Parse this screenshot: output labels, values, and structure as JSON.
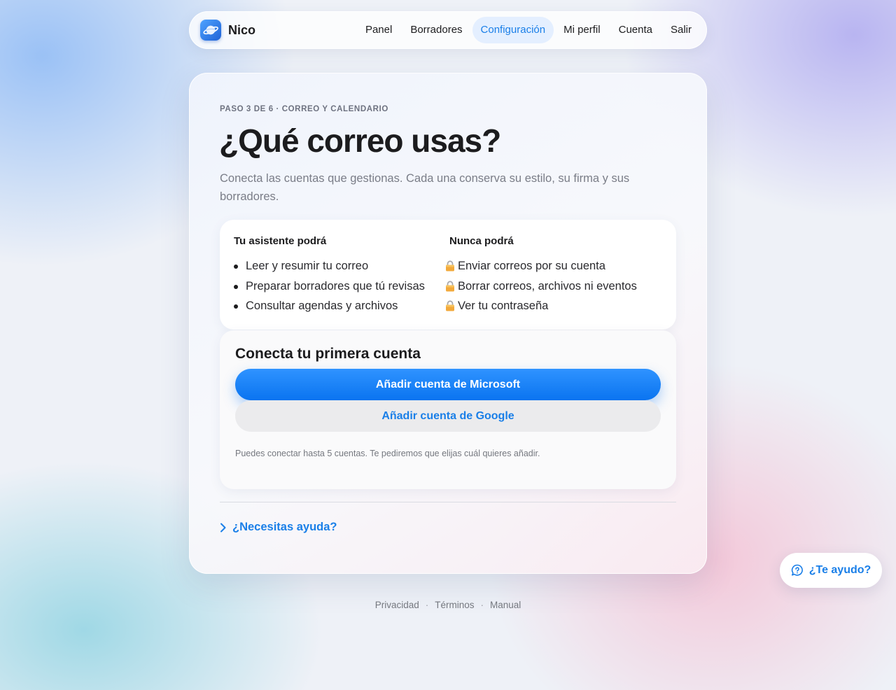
{
  "app": {
    "name": "Nico",
    "logo_icon": "planet-icon",
    "accent_color": "#1a7fe8"
  },
  "nav": {
    "items": [
      {
        "label": "Panel",
        "active": false
      },
      {
        "label": "Borradores",
        "active": false
      },
      {
        "label": "Configuración",
        "active": true
      },
      {
        "label": "Mi perfil",
        "active": false
      },
      {
        "label": "Cuenta",
        "active": false
      },
      {
        "label": "Salir",
        "active": false
      }
    ]
  },
  "step": {
    "label": "PASO 3 DE 6 · CORREO Y CALENDARIO",
    "current": 3,
    "total": 6
  },
  "page": {
    "title": "¿Qué correo usas?",
    "subtitle": "Conecta las cuentas que gestionas. Cada una conserva su estilo, su firma y sus borradores."
  },
  "permissions": {
    "can": {
      "heading": "Tu asistente podrá",
      "items": [
        "Leer y resumir tu correo",
        "Preparar borradores que tú revisas",
        "Consultar agendas y archivos"
      ]
    },
    "cannot": {
      "heading": "Nunca podrá",
      "icon": "lock-icon",
      "items": [
        "Enviar correos por su cuenta",
        "Borrar correos, archivos ni eventos",
        "Ver tu contraseña"
      ]
    }
  },
  "connect": {
    "heading": "Conecta tu primera cuenta",
    "microsoft_button": "Añadir cuenta de Microsoft",
    "google_button": "Añadir cuenta de Google",
    "note": "Puedes conectar hasta 5 cuentas. Te pediremos que elijas cuál quieres añadir."
  },
  "help": {
    "link": "¿Necesitas ayuda?",
    "icon": "chevron-right-icon"
  },
  "footer": {
    "links": [
      "Privacidad",
      "Términos",
      "Manual"
    ],
    "separator": "·"
  },
  "floating_help": {
    "label": "¿Te ayudo?",
    "icon": "help-bubble-icon"
  }
}
